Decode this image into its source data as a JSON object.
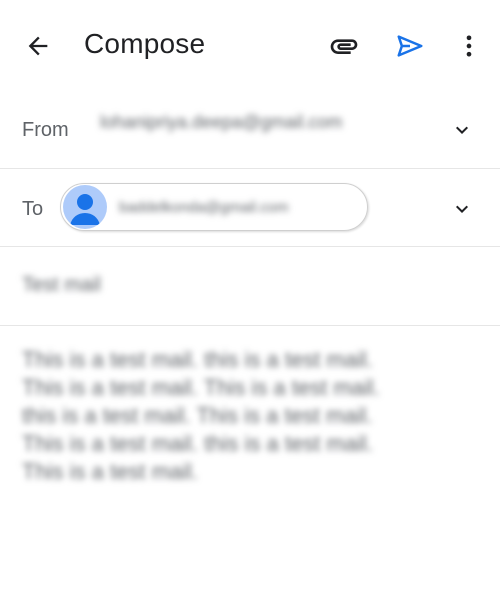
{
  "appbar": {
    "title": "Compose",
    "icons": {
      "back": "arrow-back-icon",
      "attach": "attachment-icon",
      "send": "send-icon",
      "more": "more-vert-icon"
    },
    "send_color": "#1a73e8"
  },
  "from": {
    "label": "From",
    "value": "lohanipriya.deepa@gmail.com"
  },
  "to": {
    "label": "To",
    "recipient": "baddelkonda@gmail.com"
  },
  "subject": {
    "value": "Test mail"
  },
  "body": {
    "lines": [
      "This is a test mail. this is a test mail.",
      "This is a test mail. This is a test mail.",
      "this is a test mail. This is a test mail.",
      "This is a test mail. this is a test mail.",
      "This is a test mail."
    ]
  }
}
